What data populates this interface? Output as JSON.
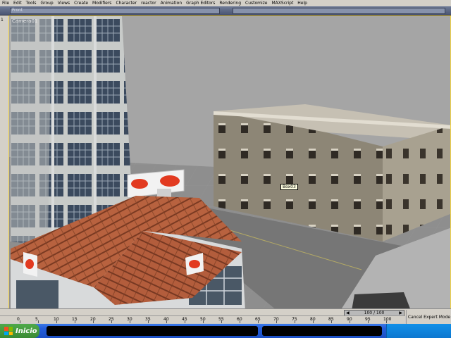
{
  "menu": {
    "items": [
      "File",
      "Edit",
      "Tools",
      "Group",
      "Views",
      "Create",
      "Modifiers",
      "Character",
      "reactor",
      "Animation",
      "Graph Editors",
      "Rendering",
      "Customize",
      "MAXScript",
      "Help"
    ]
  },
  "toolbar": {
    "field_text": "Front"
  },
  "left_panel": {
    "label": "1"
  },
  "viewport": {
    "label": "Camera01",
    "tooltip": "Box03"
  },
  "timeline": {
    "frame_counter": "100 / 100"
  },
  "ruler": {
    "ticks": [
      "0",
      "5",
      "10",
      "15",
      "20",
      "25",
      "30",
      "35",
      "40",
      "45",
      "50",
      "55",
      "60",
      "65",
      "70",
      "75",
      "80",
      "85",
      "90",
      "95",
      "100"
    ]
  },
  "status": {
    "cancel_expert": "Cancel Expert Mode"
  },
  "taskbar": {
    "start_label": "Inicio"
  },
  "colors": {
    "viewport_border": "#f0d24a",
    "taskbar": "#245edb",
    "start": "#3a8b34"
  }
}
